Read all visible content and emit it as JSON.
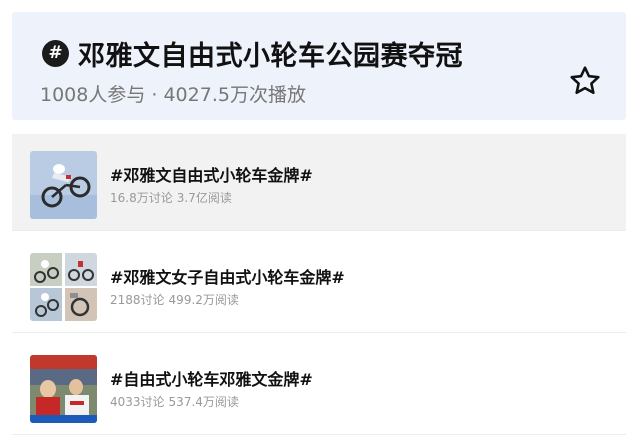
{
  "header": {
    "badge": "#",
    "title": "邓雅文自由式小轮车公园赛夺冠",
    "stats": "1008人参与 · 4027.5万次播放",
    "favorite_icon": "star-outline-icon"
  },
  "topics": [
    {
      "title": "#邓雅文自由式小轮车金牌#",
      "discussions": "16.8万讨论",
      "reads": "3.7亿阅读"
    },
    {
      "title": "#邓雅文女子自由式小轮车金牌#",
      "discussions": "2188讨论",
      "reads": "499.2万阅读"
    },
    {
      "title": "#自由式小轮车邓雅文金牌#",
      "discussions": "4033讨论",
      "reads": "537.4万阅读"
    }
  ]
}
